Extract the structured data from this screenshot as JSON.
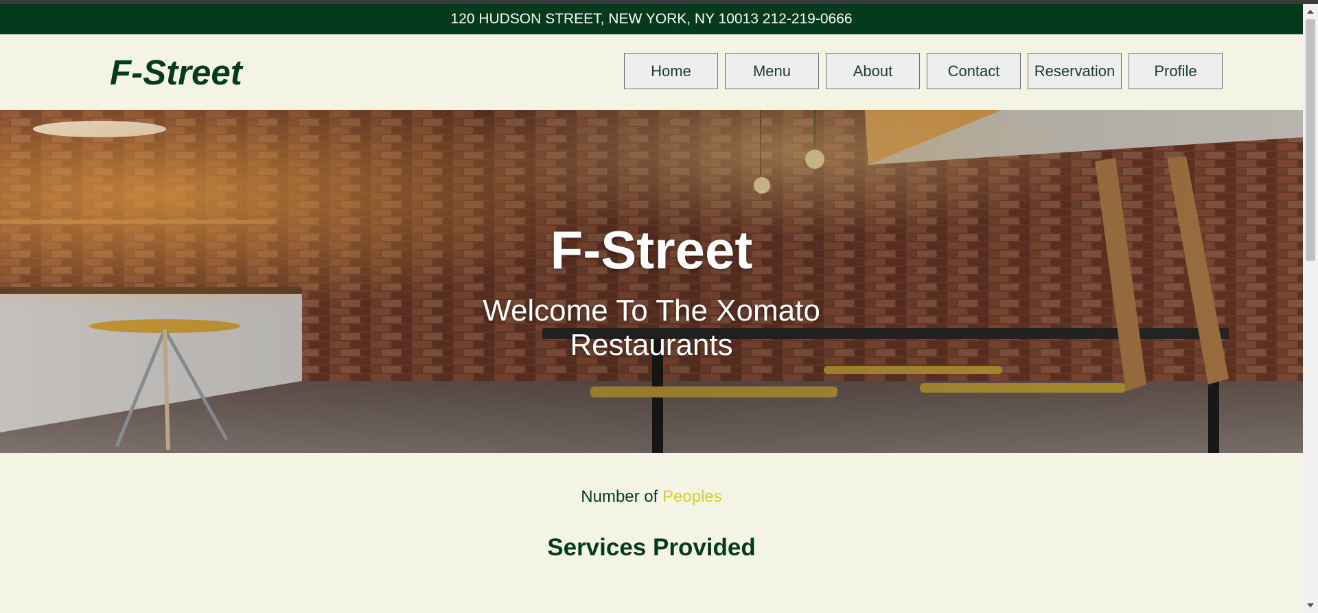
{
  "topbar": {
    "address": "120 HUDSON STREET, NEW YORK, NY 10013 212-219-0666"
  },
  "header": {
    "logo": "F-Street",
    "nav": [
      "Home",
      "Menu",
      "About",
      "Contact",
      "Reservation",
      "Profile"
    ]
  },
  "hero": {
    "title": "F-Street",
    "subtitle": "Welcome To The Xomato Restaurants"
  },
  "stats": {
    "prefix": "Number of",
    "accent": "Peoples"
  },
  "services": {
    "heading": "Services Provided"
  },
  "colors": {
    "brand_green": "#053b1c",
    "page_bg": "#f3f4e4",
    "accent_yellow": "#d4d21e",
    "button_bg": "#eeeeee"
  }
}
